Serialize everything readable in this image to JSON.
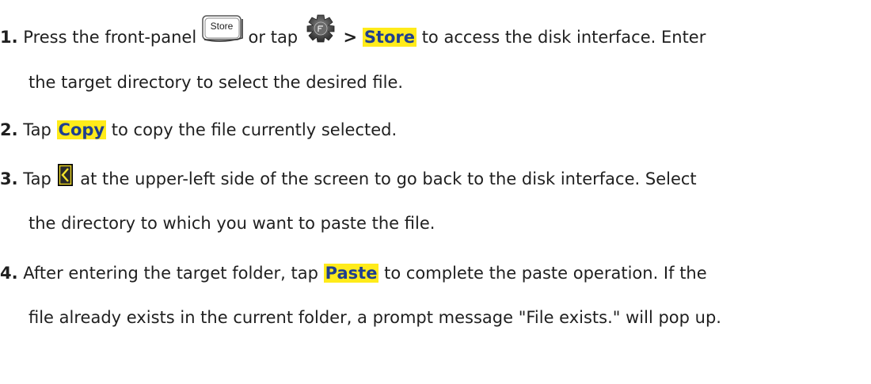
{
  "steps": [
    {
      "num": "1.",
      "t1": "Press the front-panel",
      "icon_store": "store-key-icon",
      "store_key_label": "Store",
      "t2": "or tap",
      "icon_func": "function-key-icon",
      "sep": ">",
      "hl": "Store",
      "t3": "to access the disk interface. Enter",
      "cont": "the target directory to select the desired file."
    },
    {
      "num": "2.",
      "t1": "Tap",
      "hl": "Copy",
      "t2": "to copy the file currently selected."
    },
    {
      "num": "3.",
      "t1": "Tap",
      "icon_back": "back-arrow-icon",
      "t2": "at the upper-left side of the screen to go back to the disk interface. Select",
      "cont": "the directory to which you want to paste the file."
    },
    {
      "num": "4.",
      "t1": "After entering the target folder, tap",
      "hl": "Paste",
      "t2": "to complete the paste operation. If the",
      "cont": "file already exists in the current folder, a prompt message \"File exists.\" will pop up."
    }
  ],
  "colors": {
    "highlight_bg": "#ffeb1a",
    "highlight_text": "#1f3f8f",
    "body_text": "#1f1f1f"
  }
}
